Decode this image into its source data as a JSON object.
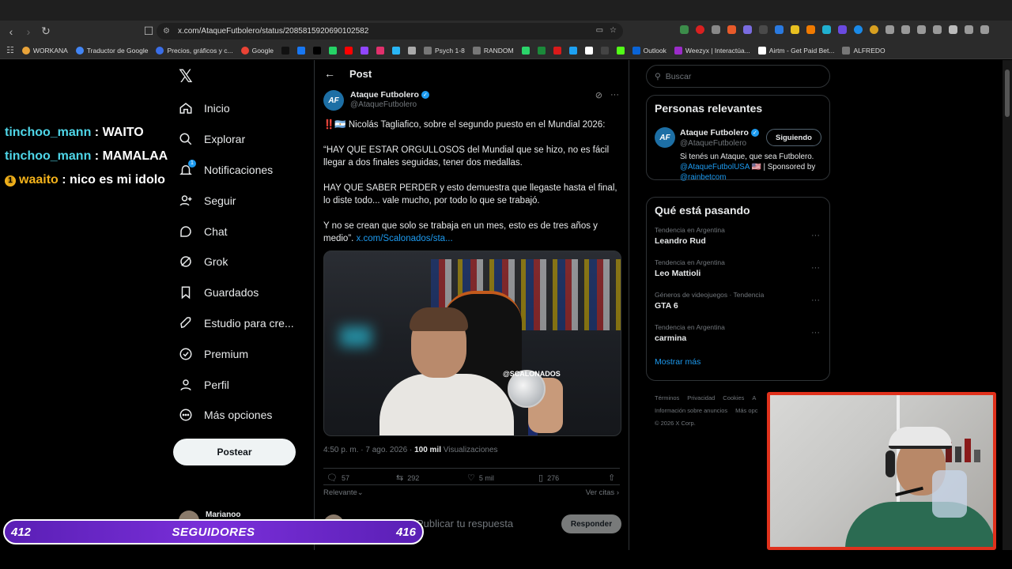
{
  "browser": {
    "url": "x.com/AtaqueFutbolero/status/2085815920690102582",
    "bookmarks": [
      {
        "label": "WORKANA",
        "color": "#e8a33a"
      },
      {
        "label": "Traductor de Google",
        "color": "#4285f4"
      },
      {
        "label": "Precios, gráficos y c...",
        "color": "#3a6ee8"
      },
      {
        "label": "Google",
        "color": "#ea4335"
      },
      {
        "label": "",
        "color": "#111"
      },
      {
        "label": "",
        "color": "#1877f2"
      },
      {
        "label": "",
        "color": "#000"
      },
      {
        "label": "",
        "color": "#25d366"
      },
      {
        "label": "",
        "color": "#ff0000"
      },
      {
        "label": "",
        "color": "#9146ff"
      },
      {
        "label": "",
        "color": "#e1306c"
      },
      {
        "label": "",
        "color": "#29b6f6"
      },
      {
        "label": "",
        "color": "#aaaaaa"
      },
      {
        "label": "Psych 1-8",
        "color": "#777"
      },
      {
        "label": "RANDOM",
        "color": "#777"
      },
      {
        "label": "",
        "color": "#2bd46a"
      },
      {
        "label": "",
        "color": "#1b8a3a"
      },
      {
        "label": "",
        "color": "#d91a1a"
      },
      {
        "label": "",
        "color": "#1da1f2"
      },
      {
        "label": "",
        "color": "#ffffff"
      },
      {
        "label": "",
        "color": "#444"
      },
      {
        "label": "",
        "color": "#53fc18"
      },
      {
        "label": "Outlook",
        "color": "#0a64d6"
      },
      {
        "label": "Weezyx | Interactúa...",
        "color": "#9b2cc9"
      },
      {
        "label": "Airtm - Get Paid Bet...",
        "color": "#ffffff"
      },
      {
        "label": "ALFREDO",
        "color": "#777"
      }
    ]
  },
  "chat": [
    {
      "user": "tinchoo_mann",
      "message": ": WAITO",
      "gold": false,
      "badge": ""
    },
    {
      "user": "tinchoo_mann",
      "message": ": MAMALAA",
      "gold": false,
      "badge": ""
    },
    {
      "user": "waaito",
      "message": ": nico es mi idolo",
      "gold": true,
      "badge": "1"
    }
  ],
  "nav": {
    "items": [
      {
        "label": "Inicio",
        "icon": "home-icon"
      },
      {
        "label": "Explorar",
        "icon": "search-icon"
      },
      {
        "label": "Notificaciones",
        "icon": "bell-icon"
      },
      {
        "label": "Seguir",
        "icon": "follow-icon"
      },
      {
        "label": "Chat",
        "icon": "chat-icon"
      },
      {
        "label": "Grok",
        "icon": "grok-icon"
      },
      {
        "label": "Guardados",
        "icon": "bookmark-icon"
      },
      {
        "label": "Estudio para cre...",
        "icon": "rocket-icon"
      },
      {
        "label": "Premium",
        "icon": "verified-icon"
      },
      {
        "label": "Perfil",
        "icon": "profile-icon"
      },
      {
        "label": "Más opciones",
        "icon": "more-icon"
      }
    ],
    "notification_count": "1",
    "post_button": "Postear",
    "account_name": "Marianoo"
  },
  "post": {
    "header": "Post",
    "author_name": "Ataque Futbolero",
    "author_handle": "@AtaqueFutbolero",
    "avatar_text": "AF",
    "para1": "‼️🇦🇷 Nicolás Tagliafico, sobre el segundo puesto en el Mundial 2026:",
    "para2": "“HAY QUE ESTAR ORGULLOSOS del Mundial que se hizo, no es fácil llegar a dos finales seguidas, tener dos medallas.",
    "para3": "HAY QUE SABER PERDER y esto demuestra que llegaste hasta el final, lo diste todo... vale mucho, por todo lo que se trabajó.",
    "para4": "Y no se crean que solo se trabaja en un mes, esto es de tres años y medio”.",
    "para4_link": "x.com/Scalonados/sta...",
    "media_watermark": "@SCALONADOS",
    "time": "4:50 p. m. · 7 ago. 2026 ·",
    "views_count": "100 mil",
    "views_label": "Visualizaciones",
    "replies": "57",
    "reposts": "292",
    "likes": "5 mil",
    "bookmarks": "276",
    "sort_label": "Relevante",
    "quotes_label": "Ver citas",
    "reply_placeholder": "Publicar tu respuesta",
    "reply_button": "Responder"
  },
  "sidebar": {
    "search_placeholder": "Buscar",
    "relevant_title": "Personas relevantes",
    "relevant_name": "Ataque Futbolero",
    "relevant_handle": "@AtaqueFutbolero",
    "follow_button": "Siguiendo",
    "bio_text": "Si tenés un Ataque, que sea Futbolero.",
    "bio_link1": "@AtaqueFutbolUSA",
    "bio_flag": "🇺🇸",
    "bio_sponsored": "| Sponsored by",
    "bio_link2": "@rainbetcom",
    "trends_title": "Qué está pasando",
    "trends": [
      {
        "category": "Tendencia en Argentina",
        "name": "Leandro Rud"
      },
      {
        "category": "Tendencia en Argentina",
        "name": "Leo Mattioli"
      },
      {
        "category": "Géneros de videojuegos · Tendencia",
        "name": "GTA 6"
      },
      {
        "category": "Tendencia en Argentina",
        "name": "carmina"
      }
    ],
    "show_more": "Mostrar más",
    "footer": [
      "Términos",
      "Privacidad",
      "Cookies",
      "A",
      "Información sobre anuncios",
      "Más opc",
      "© 2026 X Corp."
    ]
  },
  "follower_bar": {
    "current": "412",
    "label": "SEGUIDORES",
    "goal": "416"
  },
  "colors": {
    "accent": "#1d9bf0",
    "chat_user": "#4fd6e8",
    "chat_user_gold": "#f3b21b",
    "webcam_border": "#e0311c",
    "follower_bar": "#7a2fd9"
  }
}
